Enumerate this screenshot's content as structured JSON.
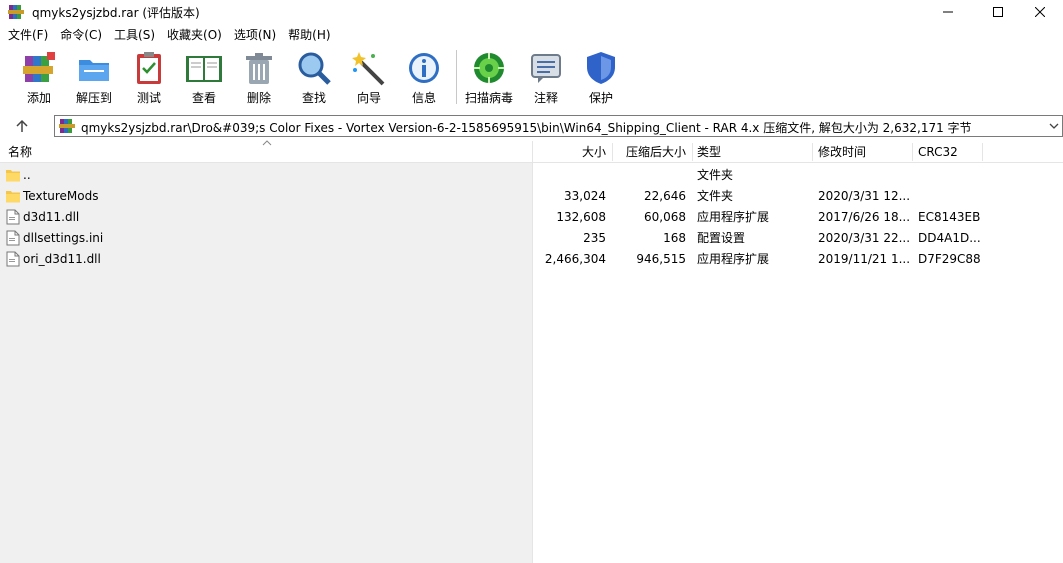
{
  "window": {
    "title": "qmyks2ysjzbd.rar (评估版本)",
    "controls": {
      "minimize": "─",
      "maximize": "☐",
      "close": "✕"
    }
  },
  "menu": [
    "文件(F)",
    "命令(C)",
    "工具(S)",
    "收藏夹(O)",
    "选项(N)",
    "帮助(H)"
  ],
  "toolbar": [
    {
      "label": "添加",
      "icon": "add-archive-icon"
    },
    {
      "label": "解压到",
      "icon": "extract-folder-icon"
    },
    {
      "label": "测试",
      "icon": "test-clipboard-icon"
    },
    {
      "label": "查看",
      "icon": "view-book-icon"
    },
    {
      "label": "删除",
      "icon": "trash-icon"
    },
    {
      "label": "查找",
      "icon": "find-magnifier-icon"
    },
    {
      "label": "向导",
      "icon": "wizard-wand-icon"
    },
    {
      "label": "信息",
      "icon": "info-icon"
    },
    {
      "label": "扫描病毒",
      "icon": "virus-scan-icon"
    },
    {
      "label": "注释",
      "icon": "comment-icon"
    },
    {
      "label": "保护",
      "icon": "protect-shield-icon"
    }
  ],
  "address": {
    "path": "qmyks2ysjzbd.rar\\Dro&#039;s Color Fixes - Vortex Version-6-2-1585695915\\bin\\Win64_Shipping_Client - RAR 4.x 压缩文件, 解包大小为 2,632,171 字节"
  },
  "columns": {
    "name": "名称",
    "size": "大小",
    "packed": "压缩后大小",
    "type": "类型",
    "modified": "修改时间",
    "crc": "CRC32"
  },
  "files": [
    {
      "name": "..",
      "size": "",
      "packed": "",
      "type": "文件夹",
      "modified": "",
      "crc": "",
      "icon": "folder-icon"
    },
    {
      "name": "TextureMods",
      "size": "33,024",
      "packed": "22,646",
      "type": "文件夹",
      "modified": "2020/3/31 12...",
      "crc": "",
      "icon": "folder-icon"
    },
    {
      "name": "d3d11.dll",
      "size": "132,608",
      "packed": "60,068",
      "type": "应用程序扩展",
      "modified": "2017/6/26 18...",
      "crc": "EC8143EB",
      "icon": "dll-file-icon"
    },
    {
      "name": "dllsettings.ini",
      "size": "235",
      "packed": "168",
      "type": "配置设置",
      "modified": "2020/3/31 22...",
      "crc": "DD4A1D...",
      "icon": "ini-file-icon"
    },
    {
      "name": "ori_d3d11.dll",
      "size": "2,466,304",
      "packed": "946,515",
      "type": "应用程序扩展",
      "modified": "2019/11/21 1...",
      "crc": "D7F29C88",
      "icon": "dll-file-icon"
    }
  ]
}
